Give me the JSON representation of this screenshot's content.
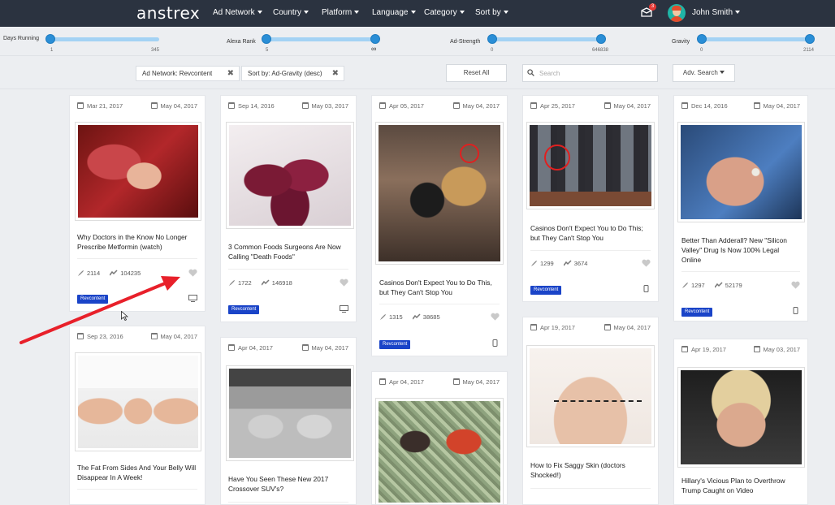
{
  "app": {
    "logo": "anstrex"
  },
  "nav": {
    "menus": [
      "Ad Network",
      "Country",
      "Platform",
      "Language",
      "Category",
      "Sort by"
    ],
    "notification_count": "3",
    "user_name": "John Smith"
  },
  "sliders": {
    "days_running": {
      "label": "Days Running",
      "min": "1",
      "max": "345"
    },
    "alexa_rank": {
      "label": "Alexa Rank",
      "min": "5",
      "max": "∞"
    },
    "ad_strength": {
      "label": "Ad-Strength",
      "min": "0",
      "max": "646838"
    },
    "gravity": {
      "label": "Gravity",
      "min": "0",
      "max": "2114"
    }
  },
  "filter_bar": {
    "chip_network": "Ad Network: Revcontent",
    "chip_sort": "Sort by: Ad-Gravity (desc)",
    "reset_label": "Reset All",
    "search_placeholder": "Search",
    "adv_search_label": "Adv. Search"
  },
  "cards": [
    {
      "first": "Mar 21, 2017",
      "last": "May 04, 2017",
      "title": "Why Doctors in the Know No Longer Prescribe Metformin (watch)",
      "reach": "2114",
      "strength": "104235",
      "network": "Revcontent",
      "device": "desktop"
    },
    {
      "first": "Sep 14, 2016",
      "last": "May 03, 2017",
      "title": "3 Common Foods Surgeons Are Now Calling \"Death Foods\"",
      "reach": "1722",
      "strength": "146918",
      "network": "Revcontent",
      "device": "desktop"
    },
    {
      "first": "Apr 05, 2017",
      "last": "May 04, 2017",
      "title": "Casinos Don't Expect You to Do This, but They Can't Stop You",
      "reach": "1315",
      "strength": "38685",
      "network": "Revcontent",
      "device": "mobile"
    },
    {
      "first": "Apr 25, 2017",
      "last": "May 04, 2017",
      "title": "Casinos Don't Expect You to Do This; but They Can't Stop You",
      "reach": "1299",
      "strength": "3674",
      "network": "Revcontent",
      "device": "mobile"
    },
    {
      "first": "Dec 14, 2016",
      "last": "May 04, 2017",
      "title": "Better Than Adderall? New \"Silicon Valley\" Drug Is Now 100% Legal Online",
      "reach": "1297",
      "strength": "52179",
      "network": "Revcontent",
      "device": "mobile"
    },
    {
      "first": "Sep 23, 2016",
      "last": "May 04, 2017",
      "title": "The Fat From Sides And Your Belly Will Disappear In A Week!"
    },
    {
      "first": "Apr 04, 2017",
      "last": "May 04, 2017",
      "title": "Have You Seen These New 2017 Crossover SUV's?"
    },
    {
      "first": "Apr 04, 2017",
      "last": "May 04, 2017"
    },
    {
      "first": "Apr 19, 2017",
      "last": "May 04, 2017",
      "title": "How to Fix Saggy Skin (doctors Shocked!)"
    },
    {
      "first": "Apr 19, 2017",
      "last": "May 03, 2017",
      "title": "Hillary's Vicious Plan to Overthrow Trump Caught on Video"
    }
  ],
  "colors": {
    "nav_bg": "#2b3340",
    "slider_accent": "#2a8ed6",
    "tag_bg": "#1a44c8",
    "annotation_arrow": "#e8202a"
  }
}
